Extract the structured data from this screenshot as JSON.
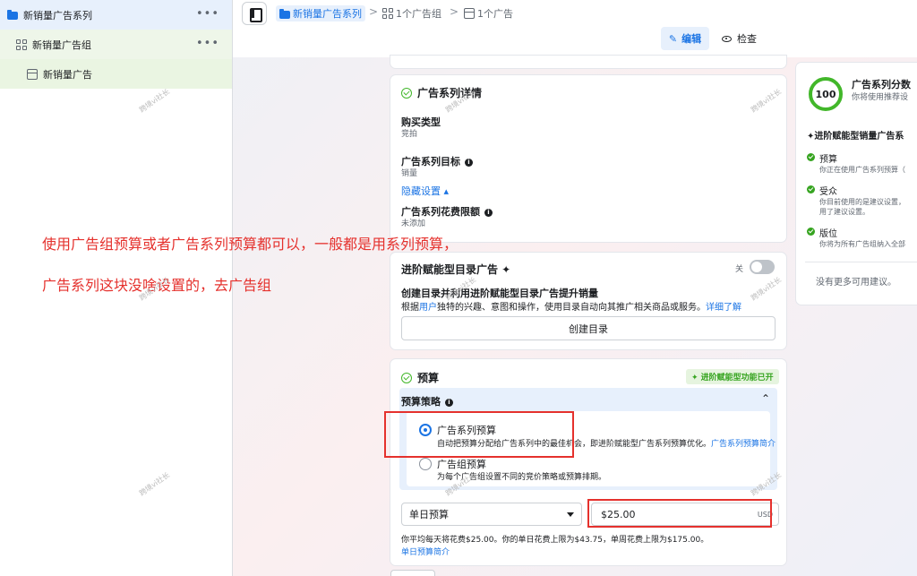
{
  "sidebar": {
    "campaign": "新销量广告系列",
    "adset": "新销量广告组",
    "ad": "新销量广告",
    "more": "•••"
  },
  "breadcrumb": {
    "campaign": "新销量广告系列",
    "adset": "1个广告组",
    "ad": "1个广告",
    "sep": ">"
  },
  "actions": {
    "edit": "编辑",
    "inspect": "检查"
  },
  "details": {
    "title": "广告系列详情",
    "buy_type_label": "购买类型",
    "buy_type_value": "竞拍",
    "objective_label": "广告系列目标",
    "objective_value": "销量",
    "hide_settings": "隐藏设置 ▴",
    "spend_limit_label": "广告系列花费限额",
    "spend_limit_value": "未添加"
  },
  "catalog": {
    "title": "进阶赋能型目录广告 ✦",
    "toggle_label": "关",
    "headline": "创建目录并利用进阶赋能型目录广告提升销量",
    "desc_pre": "根据",
    "desc_link": "用户",
    "desc_post": "独特的兴趣、意图和操作，使用目录自动向其推广相关商品或服务。",
    "learn_more": "详细了解",
    "create_button": "创建目录"
  },
  "budget": {
    "title": "预算",
    "badge": "✦ 进阶赋能型功能已开",
    "strategy_label": "预算策略",
    "option1_title": "广告系列预算",
    "option1_desc": "自动把预算分配给广告系列中的最佳机会，即进阶赋能型广告系列预算优化。",
    "option1_link": "广告系列预算简介",
    "option2_title": "广告组预算",
    "option2_desc": "为每个广告组设置不同的竞价策略或预算排期。",
    "budget_type": "单日预算",
    "amount": "$25.00",
    "currency": "USD",
    "note": "你平均每天将花费$25.00。你的单日花费上限为$43.75，单周花费上限为$175.00。",
    "intro_link": "单日预算简介"
  },
  "score": {
    "value": "100",
    "title": "广告系列分数",
    "subtitle": "你将使用推荐设",
    "section": "✦进阶赋能型销量广告系",
    "items": [
      {
        "title": "预算",
        "desc": "你正在使用广告系列预算（"
      },
      {
        "title": "受众",
        "desc": "你目前使用的是建议设置，",
        "desc2": "用了建议设置。"
      },
      {
        "title": "版位",
        "desc": "你将为所有广告组纳入全部"
      }
    ],
    "no_more": "没有更多可用建议。"
  },
  "annotation": {
    "line1": "使用广告组预算或者广告系列预算都可以，一般都是用系列预算，",
    "line2": "广告系列这块没啥设置的，去广告组"
  },
  "watermark": "跨境vi社长",
  "colors": {
    "accent": "#1b74e4",
    "annotation": "#e5312d",
    "success": "#42b72a"
  }
}
